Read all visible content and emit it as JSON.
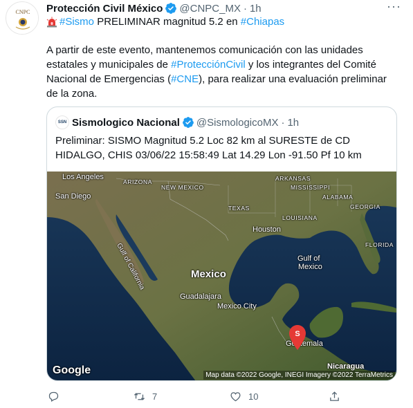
{
  "tweet": {
    "author_name": "Protección Civil México",
    "handle": "@CNPC_MX",
    "separator": "·",
    "time": "1h",
    "avatar_text": "CNPC",
    "line1": {
      "tag1": "#Sismo",
      "middle": " PRELIMINAR magnitud 5.2 en ",
      "tag2": "#Chiapas"
    },
    "body": {
      "part1": "A partir de este evento, mantenemos comunicación con las unidades estatales y municipales de ",
      "tag1": "#ProtecciónCivil",
      "part2": " y los integrantes del Comité Nacional de Emergencias (",
      "tag2": "#CNE",
      "part3": "), para realizar una evaluación preliminar de la zona."
    }
  },
  "quote": {
    "author_name": "Sismologico Nacional",
    "handle": "@SismologicoMX",
    "separator": "·",
    "time": "1h",
    "avatar_text": "SSN",
    "text": "Preliminar: SISMO Magnitud 5.2 Loc  82 km al SURESTE de CD HIDALGO, CHIS 03/06/22 15:58:49 Lat 14.29 Lon -91.50 Pf 10 km"
  },
  "map": {
    "labels": {
      "los_angeles": "Los Angeles",
      "san_diego": "San Diego",
      "arizona": "ARIZONA",
      "new_mexico": "NEW MEXICO",
      "texas": "TEXAS",
      "arkansas": "ARKANSAS",
      "mississippi": "MISSISSIPPI",
      "alabama": "ALABAMA",
      "georgia": "GEORGIA",
      "louisiana": "LOUISIANA",
      "houston": "Houston",
      "florida": "FLORIDA",
      "gulf_california": "Gulf of California",
      "gulf_mexico_1": "Gulf of",
      "gulf_mexico_2": "Mexico",
      "mexico": "Mexico",
      "guadalajara": "Guadalajara",
      "mexico_city": "Mexico City",
      "guatemala": "Guatemala",
      "nicaragua": "Nicaragua"
    },
    "pin_letter": "S",
    "google": "Google",
    "attribution": "Map data ©2022 Google, INEGI Imagery ©2022 TerraMetrics"
  },
  "actions": {
    "reply_count": "",
    "retweet_count": "7",
    "like_count": "10"
  },
  "colors": {
    "link": "#1d9bf0",
    "secondary": "#536471",
    "verified": "#1d9bf0",
    "pin": "#e53935",
    "ocean": "#0e2a4a",
    "land": "#5b6a3c"
  }
}
